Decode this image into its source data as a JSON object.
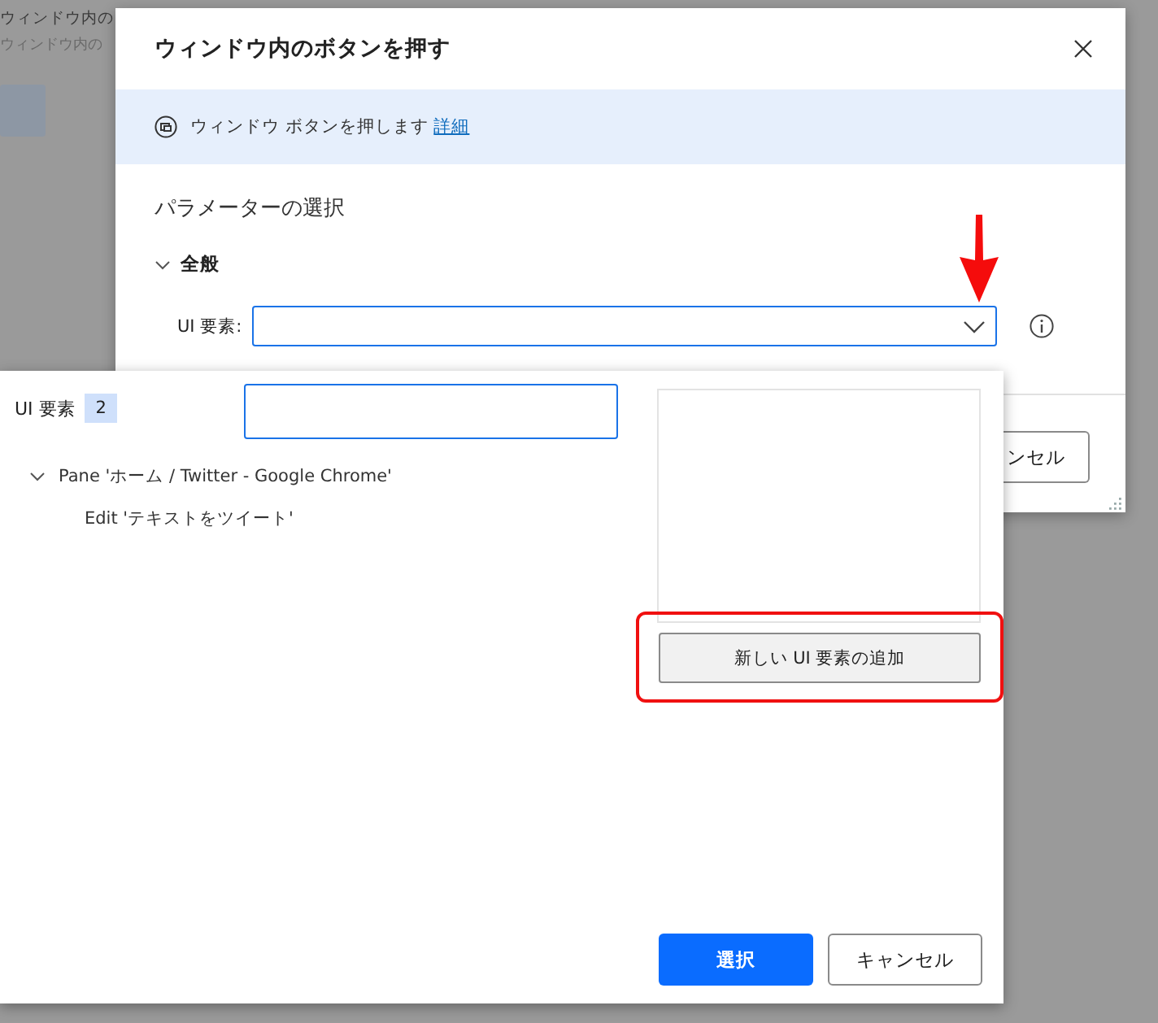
{
  "background_window": {
    "title": "ウィンドウ内の",
    "subtitle": "ウィンドウ内の"
  },
  "dialog": {
    "title": "ウィンドウ内のボタンを押す",
    "banner": {
      "text": "ウィンドウ ボタンを押します",
      "link": "詳細"
    },
    "section_title": "パラメーターの選択",
    "group": {
      "label": "全般",
      "expanded": true
    },
    "field": {
      "label": "UI 要素:"
    },
    "footer_button": "ンセル"
  },
  "picker": {
    "label": "UI 要素",
    "count": "2",
    "tree": [
      {
        "label": "Pane 'ホーム / Twitter - Google Chrome'",
        "expanded": true,
        "children": [
          {
            "label": "Edit 'テキストをツイート'"
          }
        ]
      }
    ],
    "add_button": "新しい UI 要素の追加",
    "buttons": [
      {
        "label": "選択",
        "kind": "primary"
      },
      {
        "label": "キャンセル",
        "kind": "secondary"
      }
    ]
  }
}
